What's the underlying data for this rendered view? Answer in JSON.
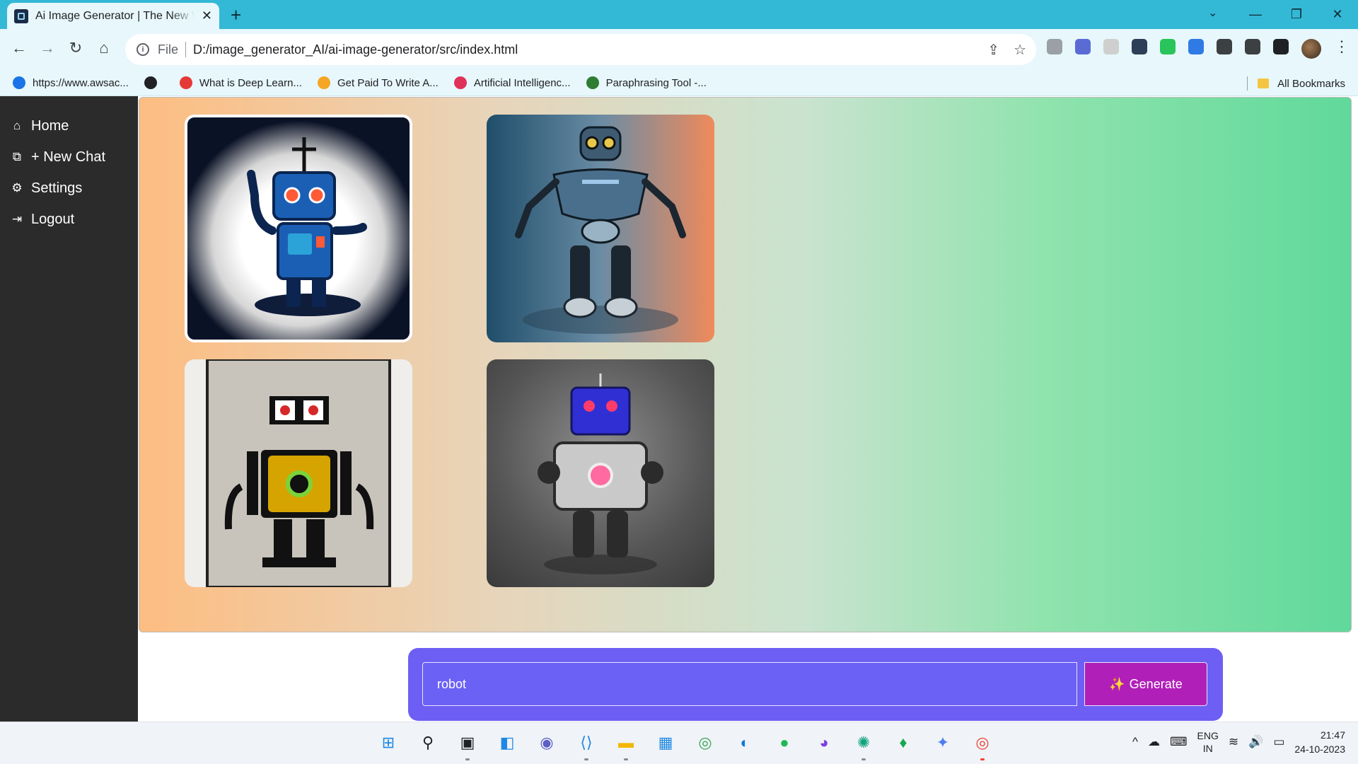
{
  "browser": {
    "tab_title": "Ai Image Generator | The New W",
    "tab_close": "✕",
    "new_tab": "+",
    "window_controls": {
      "tab_search": "⌄",
      "minimize": "—",
      "restore": "❐",
      "close": "✕"
    },
    "nav": {
      "back": "←",
      "forward": "→",
      "reload": "↻",
      "home": "⌂"
    },
    "omnibox": {
      "info": "i",
      "scheme": "File",
      "url": "D:/image_generator_AI/ai-image-generator/src/index.html",
      "share": "⇪",
      "star": "☆"
    },
    "menu": "⋮",
    "extensions": [
      "#9aa0a6",
      "#5b6bd6",
      "#cfcfcf",
      "#2d3f57",
      "#29c45a",
      "#2f7ae5",
      "#3c4043",
      "#3c4043",
      "#202124"
    ],
    "bookmarks": [
      {
        "label": "https://www.awsac...",
        "icon_color": "#1a73e8"
      },
      {
        "label": "",
        "icon_color": "#202124"
      },
      {
        "label": "What is Deep Learn...",
        "icon_color": "#e53935"
      },
      {
        "label": "Get Paid To Write A...",
        "icon_color": "#f5a623"
      },
      {
        "label": "Artificial Intelligenc...",
        "icon_color": "#e0315a"
      },
      {
        "label": "Paraphrasing Tool -...",
        "icon_color": "#2e7d32"
      }
    ],
    "all_bookmarks": "All Bookmarks"
  },
  "sidebar": {
    "items": [
      {
        "label": "Home",
        "icon": "home-icon",
        "glyph": "⌂"
      },
      {
        "label": "+ New Chat",
        "icon": "chat-icon",
        "glyph": "⧉"
      },
      {
        "label": "Settings",
        "icon": "gear-icon",
        "glyph": "⚙"
      },
      {
        "label": "Logout",
        "icon": "logout-icon",
        "glyph": "⇥"
      }
    ]
  },
  "gallery": {
    "images": [
      {
        "subject": "blue cartoon robot waving"
      },
      {
        "subject": "metallic humanoid robot"
      },
      {
        "subject": "retro poster robot with yellow chest"
      },
      {
        "subject": "blue-headed silver robot"
      }
    ]
  },
  "prompt": {
    "value": "robot",
    "button_label": "Generate",
    "button_icon": "✨"
  },
  "taskbar": {
    "apps": [
      {
        "name": "windows-start",
        "glyph": "⊞",
        "color": "#1e88e5"
      },
      {
        "name": "search",
        "glyph": "⚲",
        "color": "#202124"
      },
      {
        "name": "task-view",
        "glyph": "▣",
        "color": "#202124"
      },
      {
        "name": "widgets",
        "glyph": "◧",
        "color": "#1e88e5"
      },
      {
        "name": "teams",
        "glyph": "◉",
        "color": "#5c5fc4"
      },
      {
        "name": "vscode",
        "glyph": "⟨⟩",
        "color": "#1e88e5"
      },
      {
        "name": "file-explorer",
        "glyph": "▬",
        "color": "#f2b705"
      },
      {
        "name": "store",
        "glyph": "▦",
        "color": "#1e88e5"
      },
      {
        "name": "chrome",
        "glyph": "◎",
        "color": "#34a853"
      },
      {
        "name": "edge",
        "glyph": "◐",
        "color": "#0c7bdc"
      },
      {
        "name": "spotify",
        "glyph": "●",
        "color": "#1db954"
      },
      {
        "name": "meet",
        "glyph": "◕",
        "color": "#7b3fe4"
      },
      {
        "name": "chatgpt",
        "glyph": "✺",
        "color": "#10a37f"
      },
      {
        "name": "mongodb",
        "glyph": "♦",
        "color": "#13aa52"
      },
      {
        "name": "gemini",
        "glyph": "✦",
        "color": "#4e7cf0"
      },
      {
        "name": "chrome-active",
        "glyph": "◎",
        "color": "#ea4335"
      }
    ],
    "tray": {
      "chevron": "^",
      "cloud": "☁",
      "keyboard": "⌨",
      "lang_top": "ENG",
      "lang_bottom": "IN",
      "wifi": "≋",
      "volume": "🔊",
      "battery": "▭",
      "time": "21:47",
      "date": "24-10-2023"
    }
  }
}
